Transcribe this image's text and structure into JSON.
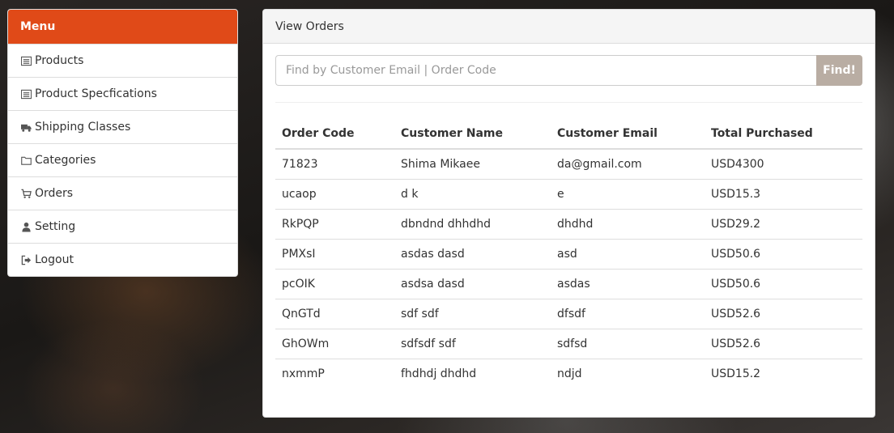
{
  "sidebar": {
    "title": "Menu",
    "items": [
      {
        "label": "Products",
        "icon": "list-icon"
      },
      {
        "label": "Product Specfications",
        "icon": "list-icon"
      },
      {
        "label": "Shipping Classes",
        "icon": "truck-icon"
      },
      {
        "label": "Categories",
        "icon": "folder-icon"
      },
      {
        "label": "Orders",
        "icon": "cart-icon"
      },
      {
        "label": "Setting",
        "icon": "user-icon"
      },
      {
        "label": "Logout",
        "icon": "sign-out-icon"
      }
    ],
    "accent_color": "#e04a18"
  },
  "panel": {
    "title": "View Orders",
    "search": {
      "placeholder": "Find by Customer Email | Order Code",
      "value": "",
      "button_label": "Find!"
    },
    "table": {
      "headers": [
        "Order Code",
        "Customer Name",
        "Customer Email",
        "Total Purchased"
      ],
      "rows": [
        [
          "71823",
          "Shima Mikaee",
          "da@gmail.com",
          "USD4300"
        ],
        [
          "ucaop",
          "d k",
          "e",
          "USD15.3"
        ],
        [
          "RkPQP",
          "dbndnd dhhdhd",
          "dhdhd",
          "USD29.2"
        ],
        [
          "PMXsI",
          "asdas dasd",
          "asd",
          "USD50.6"
        ],
        [
          "pcOIK",
          "asdsa dasd",
          "asdas",
          "USD50.6"
        ],
        [
          "QnGTd",
          "sdf sdf",
          "dfsdf",
          "USD52.6"
        ],
        [
          "GhOWm",
          "sdfsdf sdf",
          "sdfsd",
          "USD52.6"
        ],
        [
          "nxmmP",
          "fhdhdj dhdhd",
          "ndjd",
          "USD15.2"
        ]
      ]
    }
  }
}
